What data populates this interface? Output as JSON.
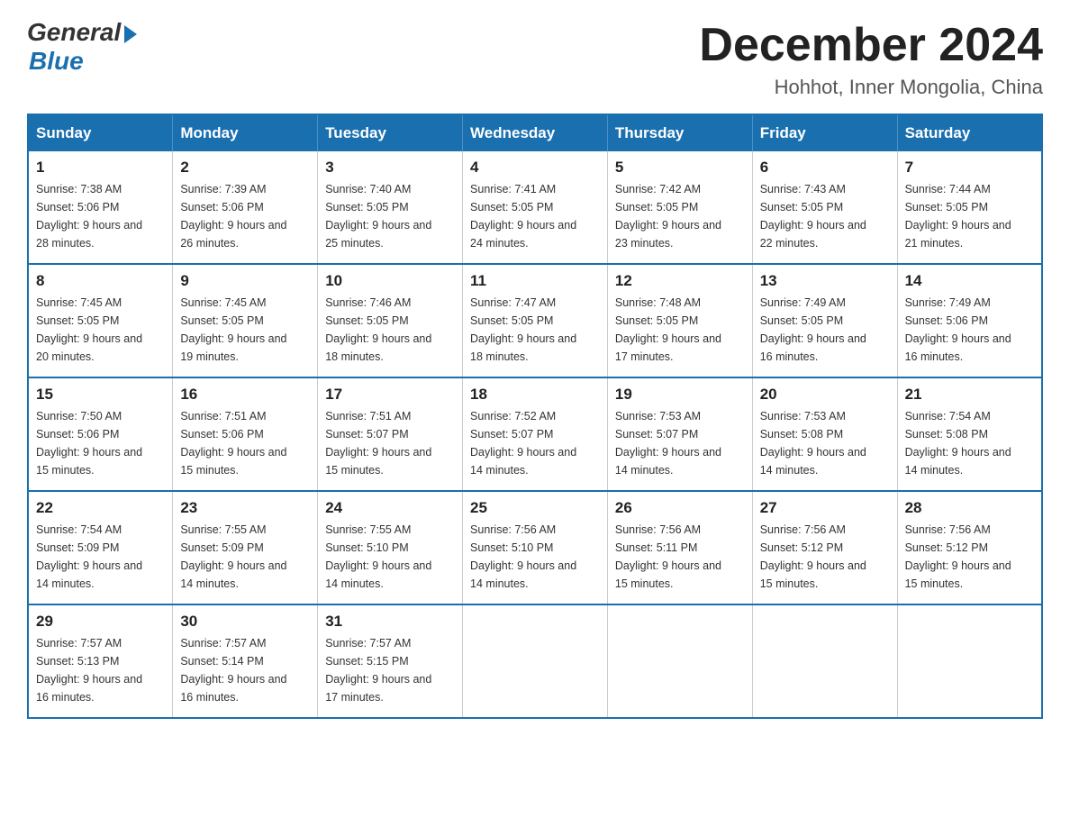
{
  "logo": {
    "general": "General",
    "blue": "Blue"
  },
  "title": "December 2024",
  "subtitle": "Hohhot, Inner Mongolia, China",
  "days_of_week": [
    "Sunday",
    "Monday",
    "Tuesday",
    "Wednesday",
    "Thursday",
    "Friday",
    "Saturday"
  ],
  "weeks": [
    [
      {
        "day": "1",
        "sunrise": "7:38 AM",
        "sunset": "5:06 PM",
        "daylight": "9 hours and 28 minutes."
      },
      {
        "day": "2",
        "sunrise": "7:39 AM",
        "sunset": "5:06 PM",
        "daylight": "9 hours and 26 minutes."
      },
      {
        "day": "3",
        "sunrise": "7:40 AM",
        "sunset": "5:05 PM",
        "daylight": "9 hours and 25 minutes."
      },
      {
        "day": "4",
        "sunrise": "7:41 AM",
        "sunset": "5:05 PM",
        "daylight": "9 hours and 24 minutes."
      },
      {
        "day": "5",
        "sunrise": "7:42 AM",
        "sunset": "5:05 PM",
        "daylight": "9 hours and 23 minutes."
      },
      {
        "day": "6",
        "sunrise": "7:43 AM",
        "sunset": "5:05 PM",
        "daylight": "9 hours and 22 minutes."
      },
      {
        "day": "7",
        "sunrise": "7:44 AM",
        "sunset": "5:05 PM",
        "daylight": "9 hours and 21 minutes."
      }
    ],
    [
      {
        "day": "8",
        "sunrise": "7:45 AM",
        "sunset": "5:05 PM",
        "daylight": "9 hours and 20 minutes."
      },
      {
        "day": "9",
        "sunrise": "7:45 AM",
        "sunset": "5:05 PM",
        "daylight": "9 hours and 19 minutes."
      },
      {
        "day": "10",
        "sunrise": "7:46 AM",
        "sunset": "5:05 PM",
        "daylight": "9 hours and 18 minutes."
      },
      {
        "day": "11",
        "sunrise": "7:47 AM",
        "sunset": "5:05 PM",
        "daylight": "9 hours and 18 minutes."
      },
      {
        "day": "12",
        "sunrise": "7:48 AM",
        "sunset": "5:05 PM",
        "daylight": "9 hours and 17 minutes."
      },
      {
        "day": "13",
        "sunrise": "7:49 AM",
        "sunset": "5:05 PM",
        "daylight": "9 hours and 16 minutes."
      },
      {
        "day": "14",
        "sunrise": "7:49 AM",
        "sunset": "5:06 PM",
        "daylight": "9 hours and 16 minutes."
      }
    ],
    [
      {
        "day": "15",
        "sunrise": "7:50 AM",
        "sunset": "5:06 PM",
        "daylight": "9 hours and 15 minutes."
      },
      {
        "day": "16",
        "sunrise": "7:51 AM",
        "sunset": "5:06 PM",
        "daylight": "9 hours and 15 minutes."
      },
      {
        "day": "17",
        "sunrise": "7:51 AM",
        "sunset": "5:07 PM",
        "daylight": "9 hours and 15 minutes."
      },
      {
        "day": "18",
        "sunrise": "7:52 AM",
        "sunset": "5:07 PM",
        "daylight": "9 hours and 14 minutes."
      },
      {
        "day": "19",
        "sunrise": "7:53 AM",
        "sunset": "5:07 PM",
        "daylight": "9 hours and 14 minutes."
      },
      {
        "day": "20",
        "sunrise": "7:53 AM",
        "sunset": "5:08 PM",
        "daylight": "9 hours and 14 minutes."
      },
      {
        "day": "21",
        "sunrise": "7:54 AM",
        "sunset": "5:08 PM",
        "daylight": "9 hours and 14 minutes."
      }
    ],
    [
      {
        "day": "22",
        "sunrise": "7:54 AM",
        "sunset": "5:09 PM",
        "daylight": "9 hours and 14 minutes."
      },
      {
        "day": "23",
        "sunrise": "7:55 AM",
        "sunset": "5:09 PM",
        "daylight": "9 hours and 14 minutes."
      },
      {
        "day": "24",
        "sunrise": "7:55 AM",
        "sunset": "5:10 PM",
        "daylight": "9 hours and 14 minutes."
      },
      {
        "day": "25",
        "sunrise": "7:56 AM",
        "sunset": "5:10 PM",
        "daylight": "9 hours and 14 minutes."
      },
      {
        "day": "26",
        "sunrise": "7:56 AM",
        "sunset": "5:11 PM",
        "daylight": "9 hours and 15 minutes."
      },
      {
        "day": "27",
        "sunrise": "7:56 AM",
        "sunset": "5:12 PM",
        "daylight": "9 hours and 15 minutes."
      },
      {
        "day": "28",
        "sunrise": "7:56 AM",
        "sunset": "5:12 PM",
        "daylight": "9 hours and 15 minutes."
      }
    ],
    [
      {
        "day": "29",
        "sunrise": "7:57 AM",
        "sunset": "5:13 PM",
        "daylight": "9 hours and 16 minutes."
      },
      {
        "day": "30",
        "sunrise": "7:57 AM",
        "sunset": "5:14 PM",
        "daylight": "9 hours and 16 minutes."
      },
      {
        "day": "31",
        "sunrise": "7:57 AM",
        "sunset": "5:15 PM",
        "daylight": "9 hours and 17 minutes."
      },
      null,
      null,
      null,
      null
    ]
  ],
  "labels": {
    "sunrise": "Sunrise:",
    "sunset": "Sunset:",
    "daylight": "Daylight:"
  }
}
